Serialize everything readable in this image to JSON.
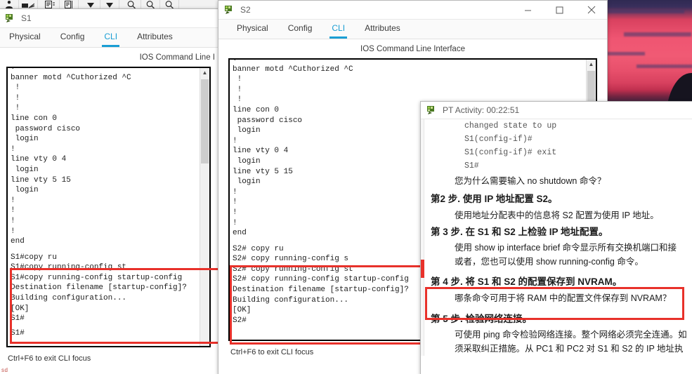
{
  "toolbar": {
    "icons": [
      "person-icon",
      "cluster-icon",
      "notes-icon",
      "panel-icon",
      "dropdown-arrow-icon",
      "dropdown-arrow-icon",
      "zoom-in-icon",
      "zoom-out-icon",
      "zoom-reset-icon"
    ]
  },
  "wallpaper": {
    "name": "sunset-wallpaper",
    "sky_top": "#2f2a52",
    "sky_mid": "#ef5572",
    "ground": "#14131f"
  },
  "windows": {
    "s1": {
      "title": "S1",
      "tabs": [
        {
          "label": "Physical",
          "active": false
        },
        {
          "label": "Config",
          "active": false
        },
        {
          "label": "CLI",
          "active": true
        },
        {
          "label": "Attributes",
          "active": false
        }
      ],
      "cli_heading": "IOS Command Line I",
      "terminal_top": "!\nbanner motd ^Cuthorized ^C\n !\n !\n !\nline con 0\n password cisco\n login\n!\nline vty 0 4\n login\nline vty 5 15\n login\n!\n!\n!\n!\nend\n",
      "terminal_highlight": "S1#copy ru\nS1#copy running-config st\nS1#copy running-config startup-config\nDestination filename [startup-config]?\nBuilding configuration...\n[OK]\nS1#",
      "terminal_prompt": "S1#",
      "focus_hint": "Ctrl+F6 to exit CLI focus",
      "accent_color": "#1a9ed4",
      "highlight_color": "#e8312a"
    },
    "s2": {
      "title": "S2",
      "tabs": [
        {
          "label": "Physical",
          "active": false
        },
        {
          "label": "Config",
          "active": false
        },
        {
          "label": "CLI",
          "active": true
        },
        {
          "label": "Attributes",
          "active": false
        }
      ],
      "cli_heading": "IOS Command Line Interface",
      "terminal_top": "!\nbanner motd ^Cuthorized ^C\n !\n !\n !\nline con 0\n password cisco\n login\n!\nline vty 0 4\n login\nline vty 5 15\n login\n!\n!\n!\n!\nend\n",
      "terminal_highlight": "S2# copy ru\nS2# copy running-config s\nS2# copy running-config st\nS2# copy running-config startup-config\nDestination filename [startup-config]?\nBuilding configuration...\n[OK]",
      "terminal_prompt": "S2#",
      "focus_hint": "Ctrl+F6 to exit CLI focus",
      "controls": {
        "minimize": "minimize-icon",
        "maximize": "maximize-icon",
        "close": "close-icon"
      }
    },
    "pt_activity": {
      "title": "PT Activity: 00:22:51",
      "console_lines": [
        "changed state to up",
        "S1(config-if)#",
        "S1(config-if)# exit",
        "S1#"
      ],
      "question": "您为什么需要输入 no shutdown 命令？",
      "question_cmd": "no shutdown",
      "steps": [
        {
          "title": "第2 步. 使用 IP 地址配置 S2。",
          "body": [
            "使用地址分配表中的信息将 S2 配置为使用 IP 地址。"
          ],
          "highlighted": false
        },
        {
          "title": "第 3 步. 在 S1 和 S2 上检验 IP 地址配置。",
          "body": [
            "使用 show ip interface brief 命令显示所有交换机端口和接",
            "或者，您也可以使用 show running-config 命令。"
          ],
          "highlighted": false
        },
        {
          "title": "第 4 步. 将 S1 和 S2 的配置保存到 NVRAM。",
          "body": [
            "哪条命令可用于将 RAM 中的配置文件保存到 NVRAM？"
          ],
          "highlighted": true
        },
        {
          "title": "第 5 步. 检验网络连接。",
          "body": [
            "可使用 ping 命令检验网络连接。整个网络必须完全连通。如",
            "须采取纠正措施。从 PC1 和 PC2 对 S1 和 S2 的 IP 地址执"
          ],
          "highlighted": false
        }
      ]
    }
  },
  "misc": {
    "corner_mark": "sd"
  }
}
